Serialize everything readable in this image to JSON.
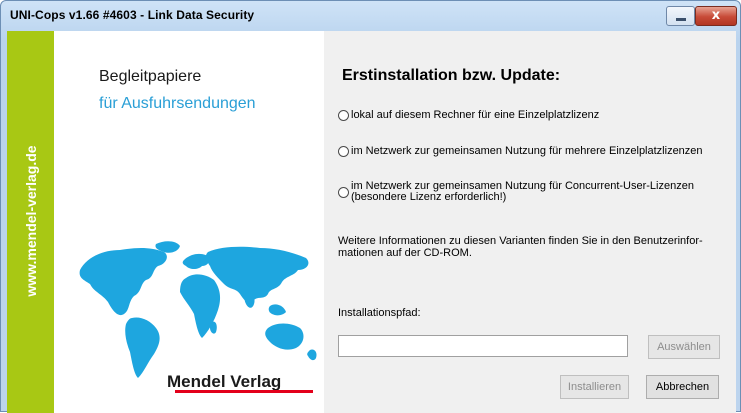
{
  "window": {
    "title": "UNI-Cops v1.66 #4603 - Link Data Security"
  },
  "controls": {
    "minimize_icon": "minimize-icon",
    "close_icon": "close-icon",
    "close_glyph": "x"
  },
  "sidebar": {
    "url": "www.mendel-verlag.de",
    "title": "Begleitpapiere",
    "subtitle": "für Ausfuhrsendungen",
    "publisher": "Mendel Verlag",
    "colors": {
      "strip": "#a8c814",
      "subtitle": "#2a9fd6",
      "map": "#1ea6df",
      "underline": "#e3001b"
    }
  },
  "main": {
    "heading": "Erstinstallation bzw. Update:",
    "options": [
      {
        "label": "lokal auf diesem Rechner für eine Einzelplatzlizenz",
        "selected": false
      },
      {
        "label": "im Netzwerk zur gemeinsamen Nutzung für mehrere Einzelplatzlizenzen",
        "selected": false
      },
      {
        "label": "im Netzwerk zur gemeinsamen Nutzung für Concurrent-User-Lizenzen",
        "label2": "(besondere Lizenz erforderlich!)",
        "selected": false
      }
    ],
    "info_line1": "Weitere Informationen zu diesen Varianten finden Sie in den Benutzerinfor-",
    "info_line2": "mationen auf der CD-ROM.",
    "path_label": "Installationspfad:",
    "path_value": "",
    "browse_label": "Auswählen",
    "install_label": "Installieren",
    "cancel_label": "Abbrechen"
  }
}
